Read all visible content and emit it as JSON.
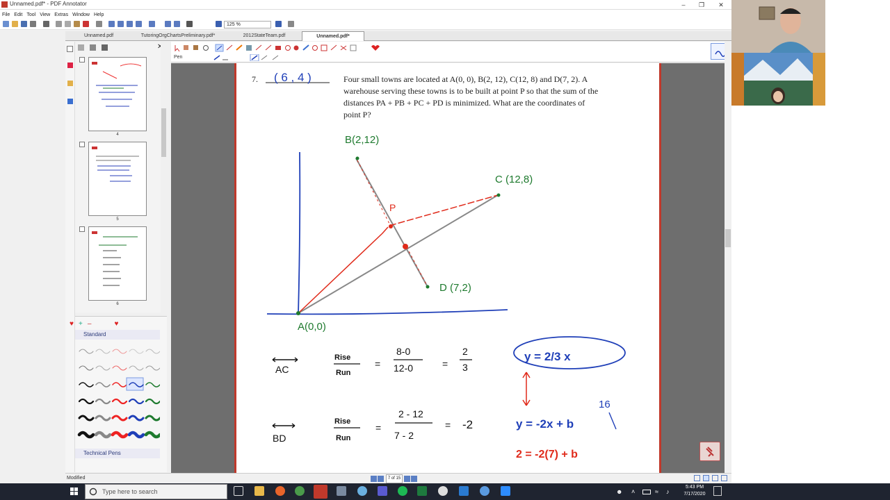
{
  "window": {
    "title": "Unnamed.pdf* - PDF Annotator"
  },
  "menu": [
    "File",
    "Edit",
    "Tool",
    "View",
    "Extras",
    "Window",
    "Help"
  ],
  "toolbar": {
    "zoom": "125 %"
  },
  "tabs": [
    {
      "label": "Unnamed.pdf"
    },
    {
      "label": "TutoringOrgChartsPreliminary.pdf*"
    },
    {
      "label": "2012StateTeam.pdf"
    },
    {
      "label": "Unnamed.pdf*"
    }
  ],
  "thumbnails": [
    {
      "num": "4"
    },
    {
      "num": "5"
    },
    {
      "num": "6"
    }
  ],
  "pen_panel": {
    "standard": "Standard",
    "technical": "Technical Pens"
  },
  "annotation_bar": {
    "tool_label": "Pen"
  },
  "status": {
    "text": "Modified",
    "page_indicator": "7 of 15"
  },
  "document": {
    "problem_number": "7.",
    "answer": "( 6 , 4 )",
    "problem_lines": [
      "Four small towns are located at A(0, 0),  B(2, 12), C(12, 8) and D(7, 2).  A",
      "warehouse serving these towns is to be built at point P so that the sum of the",
      "distances PA + PB + PC + PD is minimized.  What are the coordinates of",
      "point P?"
    ],
    "labels": {
      "B": "B(2,12)",
      "C": "C (12,8)",
      "D": "D (7,2)",
      "A": "A(0,0)",
      "P": "P"
    },
    "work": {
      "ac": "AC",
      "bd": "BD",
      "rise": "Rise",
      "run": "Run",
      "eq": "=",
      "ac_num": "8-0",
      "ac_den": "12-0",
      "ac_res_num": "2",
      "ac_res_den": "3",
      "bd_num": "2 - 12",
      "bd_den": "7 - 2",
      "bd_res": "-2",
      "line_ac": "y = 2/3 x",
      "line_bd": "y = -2x  +  b",
      "b_value": "16",
      "sub": "2 = -2(7) + b"
    }
  },
  "taskbar": {
    "search_placeholder": "Type here to search",
    "time": "5:43 PM",
    "date": "7/17/2020"
  },
  "colors": {
    "accent": "#c0392b",
    "ink_blue": "#1f3fb8",
    "ink_green": "#1e7a2e",
    "ink_red": "#e02a1a"
  }
}
